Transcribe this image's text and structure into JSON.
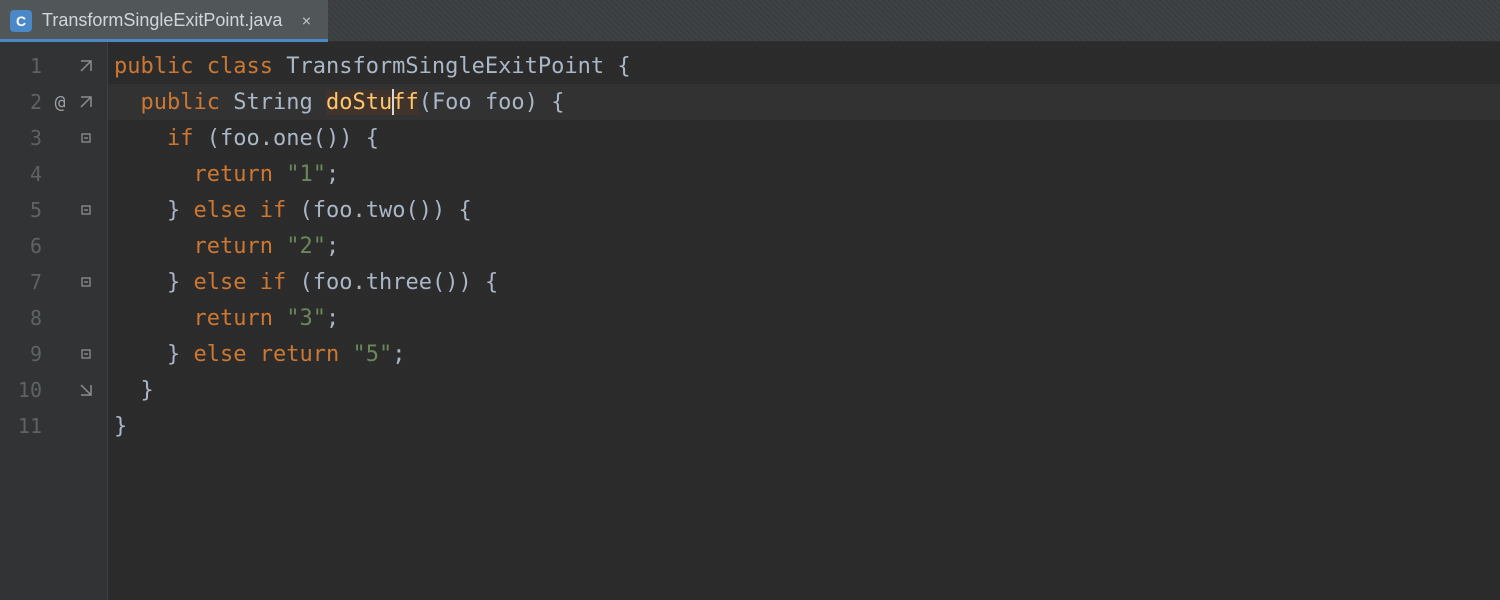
{
  "tab": {
    "icon_letter": "C",
    "filename": "TransformSingleExitPoint.java",
    "close_glyph": "×"
  },
  "gutter": {
    "lines": [
      "1",
      "2",
      "3",
      "4",
      "5",
      "6",
      "7",
      "8",
      "9",
      "10",
      "11"
    ],
    "annotation_line2": "@"
  },
  "code": {
    "class_name": "TransformSingleExitPoint",
    "method_name": "doStuff",
    "return_type": "String",
    "param_type": "Foo",
    "param_name": "foo",
    "cond1_method": "one",
    "cond2_method": "two",
    "cond3_method": "three",
    "ret1": "\"1\"",
    "ret2": "\"2\"",
    "ret3": "\"3\"",
    "ret5": "\"5\"",
    "kw_public": "public",
    "kw_class": "class",
    "kw_if": "if",
    "kw_else": "else",
    "kw_return": "return",
    "brace_open": "{",
    "brace_close": "}",
    "paren_open": "(",
    "paren_close": ")",
    "semi": ";",
    "dot": ".",
    "caret_after": "doStu"
  },
  "colors": {
    "accent": "#4a88c7",
    "keyword": "#cc7832",
    "string": "#6a8759",
    "method_decl": "#ffc66d",
    "background": "#2b2b2b",
    "gutter": "#313335"
  }
}
